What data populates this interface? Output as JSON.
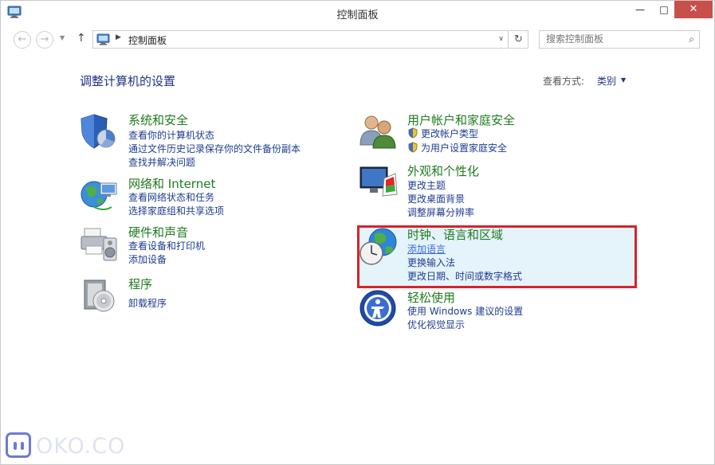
{
  "window": {
    "title": "控制面板",
    "min_glyph": "—",
    "max_glyph": "□",
    "close_glyph": "✕"
  },
  "nav": {
    "back_glyph": "←",
    "forward_glyph": "→",
    "dropdown_glyph": "▼",
    "up_glyph": "↑"
  },
  "address": {
    "separator": "▶",
    "path": "控制面板",
    "dropdown_glyph": "∨",
    "refresh_glyph": "↻"
  },
  "search": {
    "placeholder": "搜索控制面板",
    "icon_glyph": "⌕"
  },
  "content": {
    "title": "调整计算机的设置",
    "view_by_label": "查看方式:",
    "view_by_value": "类别",
    "view_caret": "▼"
  },
  "categories": {
    "system": {
      "title": "系统和安全",
      "links": [
        "查看你的计算机状态",
        "通过文件历史记录保存你的文件备份副本",
        "查找并解决问题"
      ]
    },
    "network": {
      "title": "网络和 Internet",
      "links": [
        "查看网络状态和任务",
        "选择家庭组和共享选项"
      ]
    },
    "hardware": {
      "title": "硬件和声音",
      "links": [
        "查看设备和打印机",
        "添加设备"
      ]
    },
    "programs": {
      "title": "程序",
      "links": [
        "卸载程序"
      ]
    },
    "users": {
      "title": "用户帐户和家庭安全",
      "links": [
        "更改帐户类型",
        "为用户设置家庭安全"
      ]
    },
    "appearance": {
      "title": "外观和个性化",
      "links": [
        "更改主题",
        "更改桌面背景",
        "调整屏幕分辨率"
      ]
    },
    "clock": {
      "title": "时钟、语言和区域",
      "links": [
        "添加语言",
        "更换输入法",
        "更改日期、时间或数字格式"
      ]
    },
    "ease": {
      "title": "轻松使用",
      "links": [
        "使用 Windows 建议的设置",
        "优化视觉显示"
      ]
    }
  },
  "watermark": {
    "text": "OKO.CO"
  },
  "colors": {
    "link": "#1e3c91",
    "category_title": "#1f7a1f",
    "highlight_border": "#d8232a",
    "highlight_fill": "#e5f3fb"
  }
}
